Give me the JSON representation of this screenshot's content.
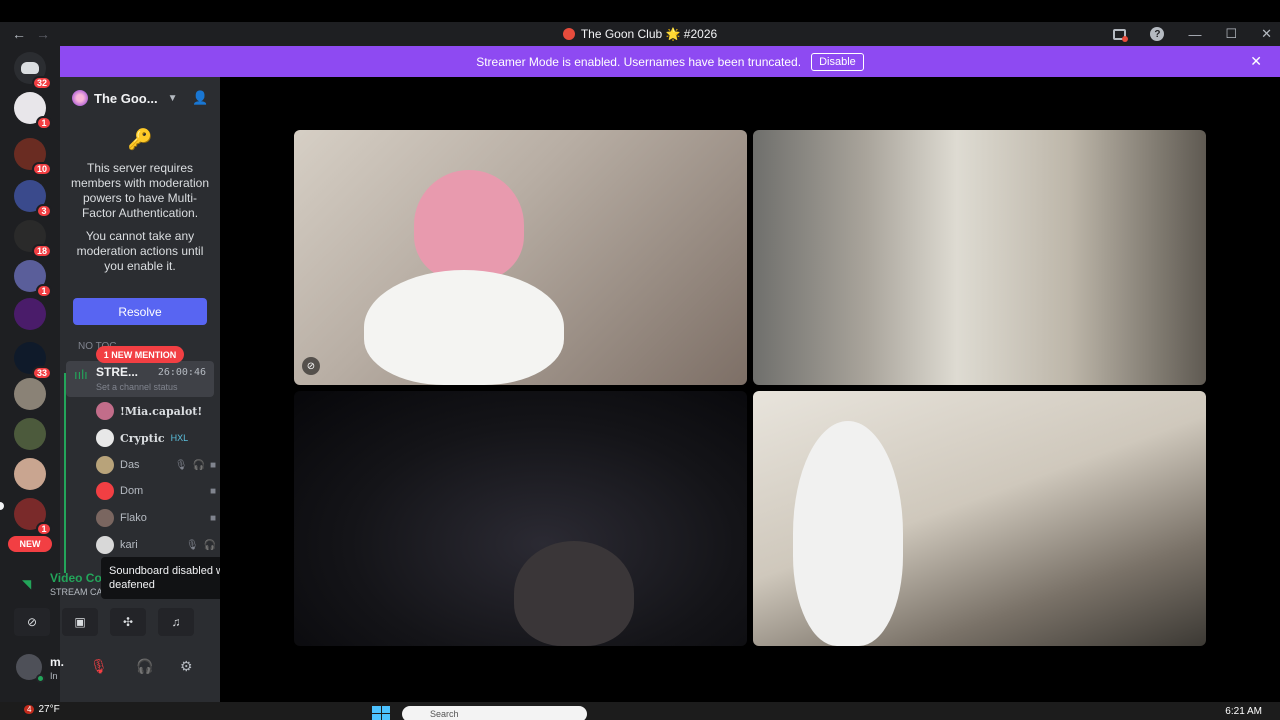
{
  "window": {
    "title": "The Goon Club 🌟 #2026",
    "back": "←",
    "forward": "→",
    "min": "—",
    "max": "☐",
    "close": "✕"
  },
  "banner": {
    "text": "Streamer Mode is enabled. Usernames have been truncated.",
    "button": "Disable"
  },
  "rail": {
    "badges": [
      "32",
      "1",
      "10",
      "3",
      "18",
      "1",
      "33",
      "1"
    ],
    "new_label": "NEW"
  },
  "server": {
    "name": "The Goo...",
    "mfa_text": "This server requires members with moderation powers to have Multi-Factor Authentication.",
    "mfa_sub": "You cannot take any moderation actions until you enable it.",
    "resolve": "Resolve"
  },
  "channels": {
    "no_toc": "NO TOC",
    "mention": "1 NEW MENTION",
    "voice": {
      "name": "STRE...",
      "timer": "26:00:46",
      "status": "Set a channel status"
    },
    "members": [
      {
        "name": "!Mia.capalot!",
        "color": "#c26d8a"
      },
      {
        "name": "Cryptic",
        "tag": "HXL",
        "color": "#e8e8e8"
      },
      {
        "name": "Das",
        "color": "#b8a37a"
      },
      {
        "name": "Dom",
        "color": "#f23f43"
      },
      {
        "name": "Flako",
        "color": "#7a6660"
      },
      {
        "name": "kari",
        "color": "#d8d8d8"
      }
    ]
  },
  "tooltip": "Soundboard disabled when deafened",
  "rtc": {
    "line1": "Video Co",
    "line2": "STREAM CA"
  },
  "user": {
    "name": "m.",
    "status": "In"
  },
  "taskbar": {
    "weather_badge": "4",
    "temp": "27°F",
    "search": "Search",
    "time": "6:21 AM"
  },
  "colors": {
    "accent": "#5865f2",
    "banner": "#8e4af2",
    "danger": "#f23f43",
    "online": "#23a55a"
  }
}
